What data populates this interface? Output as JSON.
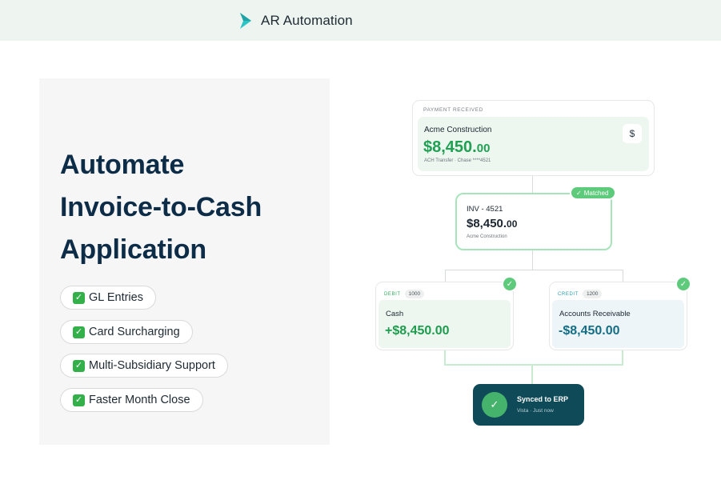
{
  "header": {
    "brand_name": "AR Automation",
    "brand_icon": "chevron-play-logo",
    "accent_color": "#2ec4c4"
  },
  "hero": {
    "headline_lines": [
      "Automate",
      "Invoice-to-Cash",
      "Application"
    ],
    "features": [
      {
        "label": "GL Entries",
        "icon": "check-box-icon"
      },
      {
        "label": "Card Surcharging",
        "icon": "check-box-icon"
      },
      {
        "label": "Multi-Subsidiary Support",
        "icon": "check-box-icon"
      },
      {
        "label": "Faster Month Close",
        "icon": "check-box-icon"
      }
    ]
  },
  "flow": {
    "payment": {
      "section_label": "PAYMENT RECEIVED",
      "payer": "Acme Construction",
      "amount_main": "$8,450.",
      "amount_cents": "00",
      "meta": "ACH Transfer · Chase ****4521",
      "icon": "$",
      "amount_color": "#20a052"
    },
    "invoice": {
      "number": "INV - 4521",
      "amount_main": "$8,450.",
      "amount_cents": "00",
      "client": "Acme Construction",
      "badge": "Matched",
      "badge_color": "#5ecb7c"
    },
    "debit": {
      "type": "DEBIT",
      "code": "1000",
      "account": "Cash",
      "amount": "+$8,450.00",
      "type_color": "#2fae5e",
      "amount_color": "#1e9c4e"
    },
    "credit": {
      "type": "CREDIT",
      "code": "1200",
      "account": "Accounts Receivable",
      "amount": "-$8,450.00",
      "type_color": "#2a9db8",
      "amount_color": "#136e86"
    },
    "sync": {
      "title": "Synced to ERP",
      "subtitle": "Vista · Just now",
      "background": "#0f4a58"
    }
  }
}
